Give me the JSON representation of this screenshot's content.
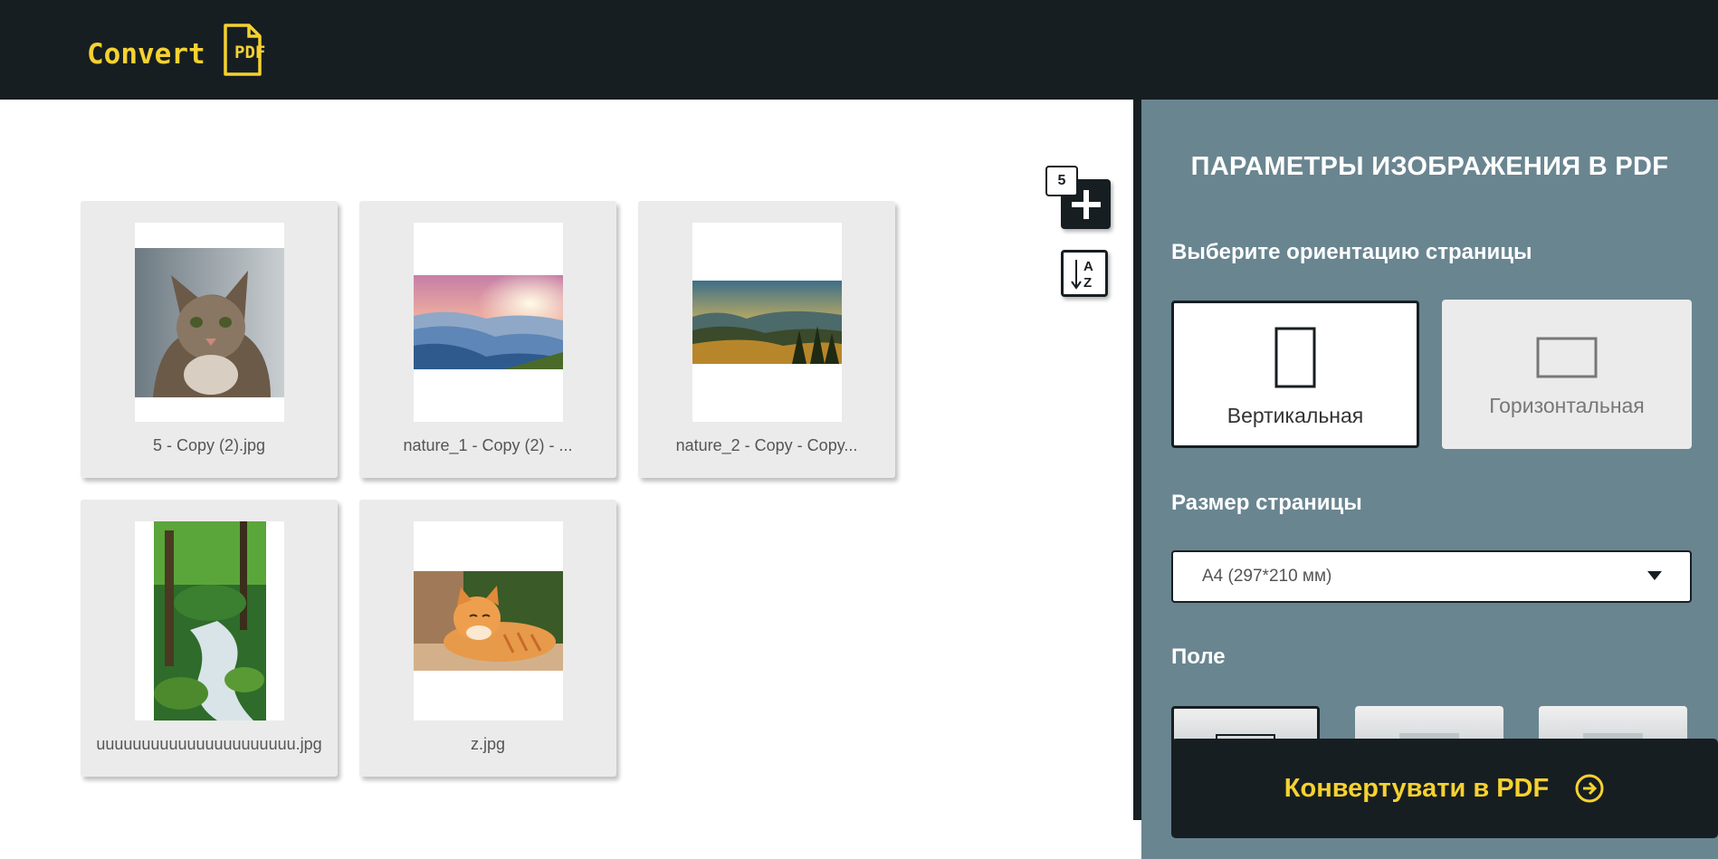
{
  "header": {
    "logo_text": "Convert",
    "logo_badge": "PDF"
  },
  "files": {
    "count": "5",
    "items": [
      {
        "caption": "5 - Copy (2).jpg",
        "thumb": "cat-tabby"
      },
      {
        "caption": "nature_1 - Copy (2) - ...",
        "thumb": "mountains-sunrise"
      },
      {
        "caption": "nature_2 - Copy - Copy...",
        "thumb": "hills-sunset"
      },
      {
        "caption": "uuuuuuuuuuuuuuuuuuuuuu.jpg",
        "thumb": "forest-stream"
      },
      {
        "caption": "z.jpg",
        "thumb": "cat-orange"
      }
    ]
  },
  "toolbar": {
    "add_icon": "plus-icon",
    "sort_icon": "sort-az-icon"
  },
  "panel": {
    "title": "ПАРАМЕТРЫ ИЗОБРАЖЕНИЯ В PDF",
    "orientation_label": "Выберите ориентацию страницы",
    "orientation_options": [
      {
        "label": "Вертикальная",
        "selected": true
      },
      {
        "label": "Горизонтальная",
        "selected": false
      }
    ],
    "size_label": "Размер страницы",
    "size_value": "A4 (297*210 мм)",
    "margin_label": "Поле",
    "convert_label": "Конвертувати в PDF"
  },
  "colors": {
    "header_bg": "#171e22",
    "accent": "#f5d230",
    "panel_bg": "#698590"
  }
}
